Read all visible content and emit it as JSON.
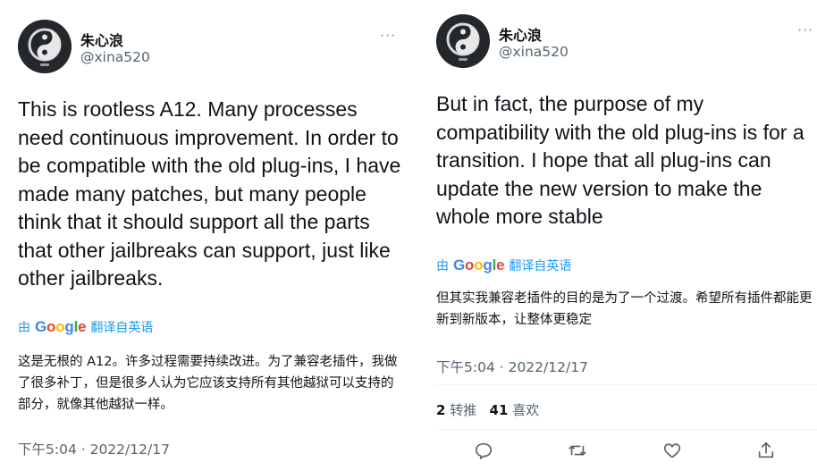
{
  "left_tweet": {
    "author": {
      "name": "朱心浪",
      "handle": "@xina520"
    },
    "more_icon": "more-dots-icon",
    "text": "This is rootless A12. Many processes need continuous improvement. In order to be compatible with the old plug-ins, I have made many patches, but many people think that it should support all the parts that other jailbreaks can support, just like other jailbreaks.",
    "translate_prefix": "由",
    "translate_brand": "Google",
    "translate_suffix": "翻译自英语",
    "translated_text": "这是无根的 A12。许多过程需要持续改进。为了兼容老插件，我做了很多补丁，但是很多人认为它应该支持所有其他越狱可以支持的部分，就像其他越狱一样。",
    "timestamp": "下午5:04 · 2022/12/17"
  },
  "right_tweet": {
    "author": {
      "name": "朱心浪",
      "handle": "@xina520"
    },
    "more_icon": "more-dots-icon",
    "text": "But in fact, the purpose of my compatibility with the old plug-ins is for a transition. I hope that all plug-ins can update the new version to make the whole more stable",
    "translate_prefix": "由",
    "translate_brand": "Google",
    "translate_suffix": "翻译自英语",
    "translated_text": "但其实我兼容老插件的目的是为了一个过渡。希望所有插件都能更新到新版本，让整体更稳定",
    "timestamp": "下午5:04 · 2022/12/17",
    "stats": {
      "retweets_count": "2",
      "retweets_label": "转推",
      "likes_count": "41",
      "likes_label": "喜欢"
    },
    "actions": [
      "reply-icon",
      "retweet-icon",
      "like-icon",
      "share-icon"
    ]
  },
  "colors": {
    "text_primary": "#0f1419",
    "text_secondary": "#536471",
    "link_blue": "#1d9bf0"
  }
}
